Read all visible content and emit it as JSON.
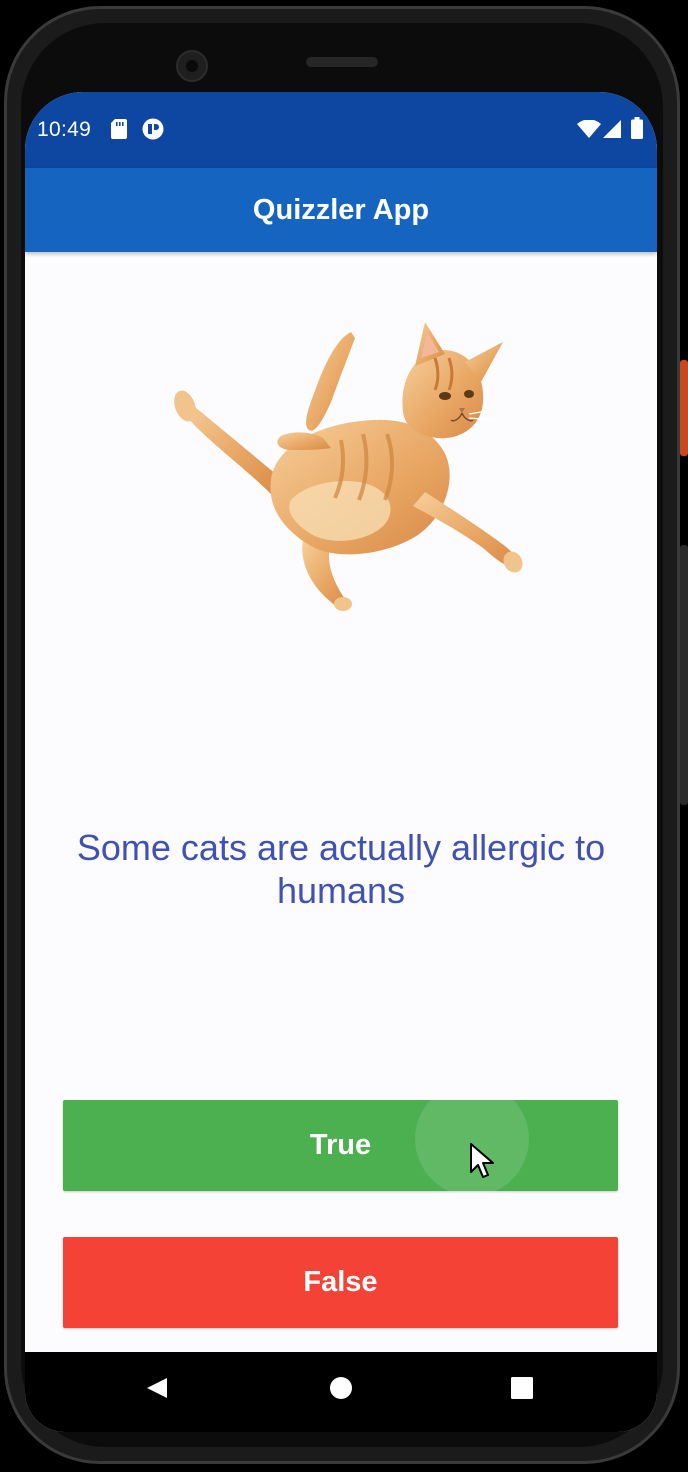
{
  "status_bar": {
    "time": "10:49",
    "left_icons": [
      "sd-card-icon",
      "app-notification-icon"
    ],
    "right_icons": [
      "wifi-icon",
      "cellular-signal-icon",
      "battery-icon"
    ]
  },
  "app_bar": {
    "title": "Quizzler App"
  },
  "question": {
    "image": "flying-cat-image",
    "text": "Some cats are actually allergic to humans"
  },
  "answers": {
    "true_label": "True",
    "false_label": "False"
  },
  "navigation": {
    "icons": [
      "back-icon",
      "home-icon",
      "recents-icon"
    ]
  },
  "colors": {
    "status_bar": "#0d47a1",
    "app_bar": "#1565c0",
    "question_text": "#3f51b5",
    "true_button": "#4caf50",
    "false_button": "#f44336"
  }
}
